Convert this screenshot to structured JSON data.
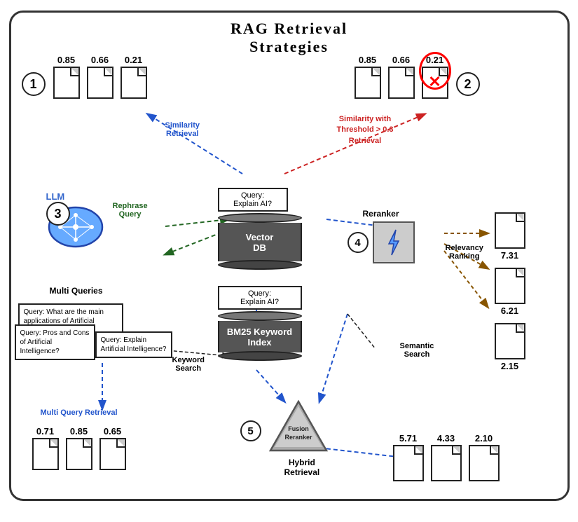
{
  "title": {
    "line1": "RAG Retrieval",
    "line2": "Strategies"
  },
  "section1": {
    "label": "1",
    "scores": [
      "0.85",
      "0.66",
      "0.21"
    ],
    "tag": "Similarity\nRetrieval"
  },
  "section2": {
    "label": "2",
    "scores": [
      "0.85",
      "0.66",
      "0.21"
    ],
    "tag": "Similarity with\nThreshold > 0.3\nRetrieval"
  },
  "section3": {
    "label": "3",
    "llm_label": "LLM",
    "rephrase": "Rephrase\nQuery",
    "multi_queries": "Multi Queries",
    "queries": [
      "Query: What are the\nmain applications\nof Artificial\nIntelligence?",
      "Query: Pros and\nCons of Artificial\nIntelligence?",
      "Query: Explain\nArtificial\nIntelligence?"
    ],
    "multi_query_retrieval": "Multi Query Retrieval",
    "doc_scores": [
      "0.71",
      "0.85",
      "0.65"
    ]
  },
  "section4": {
    "label": "4",
    "reranker_label": "Reranker",
    "relevancy": "Relevancy\nRanking",
    "doc_scores": [
      "7.31",
      "6.21",
      "2.15"
    ]
  },
  "section5": {
    "label": "5",
    "fusion_label": "Fusion\nReranker",
    "hybrid": "Hybrid\nRetrieval",
    "keyword_search": "Keyword\nSearch",
    "semantic_search": "Semantic\nSearch",
    "doc_scores": [
      "5.71",
      "4.33",
      "2.10"
    ]
  },
  "vectordb": {
    "query_label": "Query:\nExplain AI?",
    "label": "Vector\nDB"
  },
  "bm25": {
    "query_label": "Query:\nExplain AI?",
    "label": "BM25 Keyword\nIndex"
  }
}
